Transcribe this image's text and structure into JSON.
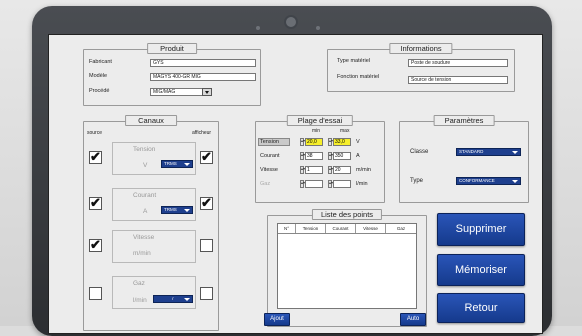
{
  "produit": {
    "title": "Produit",
    "fabricant_label": "Fabricant",
    "fabricant_value": "GYS",
    "modele_label": "Modèle",
    "modele_value": "MAGYS 400-GR MIG",
    "procede_label": "Procédé",
    "procede_value": "MIG/MAG"
  },
  "informations": {
    "title": "Informations",
    "type_label": "Type matériel",
    "type_value": "Poste de soudure",
    "fonction_label": "Fonction matériel",
    "fonction_value": "Source de tension"
  },
  "canaux": {
    "title": "Canaux",
    "source_label": "source",
    "afficheur_label": "afficheur",
    "items": [
      {
        "name": "Tension",
        "unit": "V",
        "select": "TRMS",
        "source": true,
        "afficheur": true
      },
      {
        "name": "Courant",
        "unit": "A",
        "select": "TRMS",
        "source": true,
        "afficheur": true
      },
      {
        "name": "Vitesse",
        "unit": "m/min",
        "source": true,
        "afficheur": false
      },
      {
        "name": "Gaz",
        "unit": "l/min",
        "select": "             r",
        "source": false,
        "afficheur": false
      }
    ]
  },
  "plage": {
    "title": "Plage d'essai",
    "min_label": "min",
    "max_label": "max",
    "rows": [
      {
        "label": "Tension",
        "min": "20,0",
        "max": "33,0",
        "unit": "V"
      },
      {
        "label": "Courant",
        "min": "38",
        "max": "350",
        "unit": "A"
      },
      {
        "label": "Vitesse",
        "min": "1",
        "max": "20",
        "unit": "m/min"
      },
      {
        "label": "Gaz",
        "min": "",
        "max": "",
        "unit": "l/min"
      }
    ]
  },
  "parametres": {
    "title": "Paramètres",
    "classe_label": "Classe",
    "classe_value": "STANDARD",
    "type_label": "Type",
    "type_value": "CONFORMANCE"
  },
  "liste": {
    "title": "Liste des points",
    "columns": [
      "N°",
      "Tension",
      "Courant",
      "Vitesse",
      "Gaz"
    ],
    "ajout_label": "Ajout",
    "auto_label": "Auto"
  },
  "actions": {
    "supprimer": "Supprimer",
    "memoriser": "Mémoriser",
    "retour": "Retour"
  },
  "colors": {
    "button_blue": "#1e3f8e",
    "highlight_yellow": "#f6ef2a"
  }
}
